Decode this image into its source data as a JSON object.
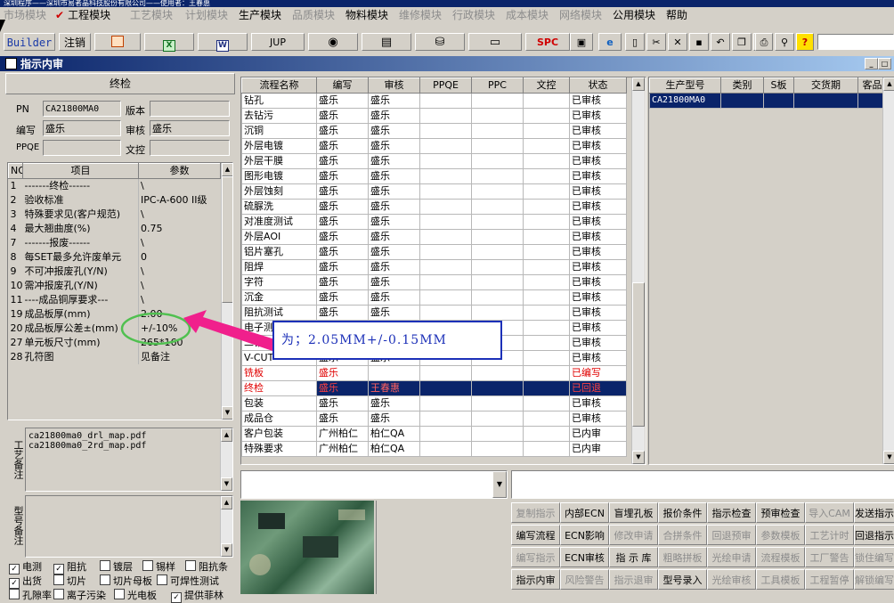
{
  "title_bar": "深圳程序——深圳市易者晶科技股份有限公司——使用者：王春惠",
  "menu": [
    {
      "label": "市场模块",
      "dim": true
    },
    {
      "label": "工程模块",
      "dim": false
    },
    {
      "label": "工艺模块",
      "dim": true
    },
    {
      "label": "计划模块",
      "dim": true
    },
    {
      "label": "生产模块",
      "dim": false
    },
    {
      "label": "品质模块",
      "dim": true
    },
    {
      "label": "物料模块",
      "dim": false
    },
    {
      "label": "维修模块",
      "dim": true
    },
    {
      "label": "行政模块",
      "dim": true
    },
    {
      "label": "成本模块",
      "dim": true
    },
    {
      "label": "网络模块",
      "dim": true
    },
    {
      "label": "公用模块",
      "dim": false
    },
    {
      "label": "帮助",
      "dim": false
    }
  ],
  "toolbar": {
    "builder": "Builder",
    "logout": "注销",
    "jup": "JUP",
    "spc": "SPC"
  },
  "window_title": "指示内审",
  "left": {
    "section_title": "终检",
    "pn_label": "PN",
    "pn_value": "CA21800MA0",
    "version_label": "版本",
    "version_value": "",
    "writer_label": "编写",
    "writer_value": "盛乐",
    "reviewer_label": "审核",
    "reviewer_value": "盛乐",
    "ppqe_label": "PPQE",
    "ppqe_value": "",
    "doc_label": "文控",
    "doc_value": "",
    "param_headers": [
      "NO",
      "项目",
      "参数"
    ],
    "params": [
      [
        "1",
        "-------终检------",
        "\\"
      ],
      [
        "2",
        "验收标准",
        "IPC-A-600 II级"
      ],
      [
        "3",
        "特殊要求见(客户规范)",
        "\\"
      ],
      [
        "4",
        "最大翘曲度(%)",
        "0.75"
      ],
      [
        "7",
        "-------报废------",
        "\\"
      ],
      [
        "8",
        "每SET最多允许废单元",
        "0"
      ],
      [
        "9",
        "不可冲报废孔(Y/N)",
        "\\"
      ],
      [
        "10",
        "需冲报废孔(Y/N)",
        "\\"
      ],
      [
        "11",
        "----成品铜厚要求---",
        "\\"
      ],
      [
        "19",
        "成品板厚(mm)",
        "2.00"
      ],
      [
        "20",
        "成品板厚公差±(mm)",
        "+/-10%"
      ],
      [
        "27",
        "单元板尺寸(mm)",
        "265*160"
      ],
      [
        "28",
        "孔符图",
        "见备注"
      ]
    ],
    "process_note_label": "工艺备注",
    "process_notes": [
      "ca21800ma0_drl_map.pdf",
      "ca21800ma0_2rd_map.pdf"
    ],
    "model_note_label": "型号备注",
    "checkboxes": [
      {
        "label": "电测",
        "checked": true
      },
      {
        "label": "阻抗",
        "checked": true
      },
      {
        "label": "镀层",
        "checked": false
      },
      {
        "label": "锡样",
        "checked": false
      },
      {
        "label": "阻抗条",
        "checked": false
      },
      {
        "label": "出货",
        "checked": true
      },
      {
        "label": "切片",
        "checked": false
      },
      {
        "label": "切片母板",
        "checked": false
      },
      {
        "label": "可焊性测试",
        "checked": false
      },
      {
        "label": "孔隙率",
        "checked": false
      },
      {
        "label": "离子污染",
        "checked": false
      },
      {
        "label": "光电板",
        "checked": false
      },
      {
        "label": "提供菲林",
        "checked": true
      }
    ]
  },
  "flow": {
    "headers": [
      "流程名称",
      "编写",
      "审核",
      "PPQE",
      "PPC",
      "文控",
      "状态"
    ],
    "rows": [
      [
        "钻孔",
        "盛乐",
        "盛乐",
        "",
        "",
        "",
        "已审核"
      ],
      [
        "去钻污",
        "盛乐",
        "盛乐",
        "",
        "",
        "",
        "已审核"
      ],
      [
        "沉铜",
        "盛乐",
        "盛乐",
        "",
        "",
        "",
        "已审核"
      ],
      [
        "外层电镀",
        "盛乐",
        "盛乐",
        "",
        "",
        "",
        "已审核"
      ],
      [
        "外层干膜",
        "盛乐",
        "盛乐",
        "",
        "",
        "",
        "已审核"
      ],
      [
        "图形电镀",
        "盛乐",
        "盛乐",
        "",
        "",
        "",
        "已审核"
      ],
      [
        "外层蚀刻",
        "盛乐",
        "盛乐",
        "",
        "",
        "",
        "已审核"
      ],
      [
        "硫脲洗",
        "盛乐",
        "盛乐",
        "",
        "",
        "",
        "已审核"
      ],
      [
        "对准度测试",
        "盛乐",
        "盛乐",
        "",
        "",
        "",
        "已审核"
      ],
      [
        "外层AOI",
        "盛乐",
        "盛乐",
        "",
        "",
        "",
        "已审核"
      ],
      [
        "铝片塞孔",
        "盛乐",
        "盛乐",
        "",
        "",
        "",
        "已审核"
      ],
      [
        "阻焊",
        "盛乐",
        "盛乐",
        "",
        "",
        "",
        "已审核"
      ],
      [
        "字符",
        "盛乐",
        "盛乐",
        "",
        "",
        "",
        "已审核"
      ],
      [
        "沉金",
        "盛乐",
        "盛乐",
        "",
        "",
        "",
        "已审核"
      ],
      [
        "阻抗测试",
        "盛乐",
        "盛乐",
        "",
        "",
        "",
        "已审核"
      ],
      [
        "电子测",
        "盛乐",
        "盛乐",
        "",
        "",
        "",
        "已审核"
      ],
      [
        "二钻",
        "盛乐",
        "盛乐",
        "",
        "",
        "",
        "已审核"
      ],
      [
        "V-CUT",
        "盛乐",
        "盛乐",
        "",
        "",
        "",
        "已审核"
      ],
      [
        "铣板",
        "盛乐",
        "",
        "",
        "",
        "",
        "已编写"
      ],
      [
        "终检",
        "盛乐",
        "王春惠",
        "",
        "",
        "",
        "已回退"
      ],
      [
        "包装",
        "盛乐",
        "盛乐",
        "",
        "",
        "",
        "已审核"
      ],
      [
        "成品仓",
        "盛乐",
        "盛乐",
        "",
        "",
        "",
        "已审核"
      ],
      [
        "客户包装",
        "广州柏仁",
        "柏仁QA",
        "",
        "",
        "",
        "已内审"
      ],
      [
        "特殊要求",
        "广州柏仁",
        "柏仁QA",
        "",
        "",
        "",
        "已内审"
      ]
    ],
    "red_row": 18,
    "selected_row": 19
  },
  "right": {
    "headers": [
      "生产型号",
      "类别",
      "S板",
      "交货期",
      "客品"
    ],
    "rows": [
      [
        "CA21800MA0",
        "",
        "",
        "",
        ""
      ]
    ]
  },
  "annotation": {
    "text": "为；2.05MM+/-0.15MM"
  },
  "actions": [
    [
      {
        "label": "复制指示",
        "dim": true
      },
      {
        "label": "内部ECN",
        "dim": false
      },
      {
        "label": "盲埋孔板",
        "dim": false
      },
      {
        "label": "报价条件",
        "dim": false
      },
      {
        "label": "指示检查",
        "dim": false
      },
      {
        "label": "预审检查",
        "dim": false
      },
      {
        "label": "导入CAM",
        "dim": true
      },
      {
        "label": "发送指示",
        "dim": false
      }
    ],
    [
      {
        "label": "编写流程",
        "dim": false
      },
      {
        "label": "ECN影响",
        "dim": false
      },
      {
        "label": "修改申请",
        "dim": true
      },
      {
        "label": "合拼条件",
        "dim": true
      },
      {
        "label": "回退预审",
        "dim": true
      },
      {
        "label": "参数模板",
        "dim": true
      },
      {
        "label": "工艺计时",
        "dim": true
      },
      {
        "label": "回退指示",
        "dim": false
      }
    ],
    [
      {
        "label": "编写指示",
        "dim": true
      },
      {
        "label": "ECN审核",
        "dim": false
      },
      {
        "label": "指 示 库",
        "dim": false
      },
      {
        "label": "粗略拼板",
        "dim": true
      },
      {
        "label": "光绘申请",
        "dim": true
      },
      {
        "label": "流程模板",
        "dim": true
      },
      {
        "label": "工厂警告",
        "dim": true
      },
      {
        "label": "锁住编写",
        "dim": true
      }
    ],
    [
      {
        "label": "指示内审",
        "dim": false
      },
      {
        "label": "风险警告",
        "dim": true
      },
      {
        "label": "指示退审",
        "dim": true
      },
      {
        "label": "型号录入",
        "dim": false
      },
      {
        "label": "光绘审核",
        "dim": true
      },
      {
        "label": "工具模板",
        "dim": true
      },
      {
        "label": "工程暂停",
        "dim": true
      },
      {
        "label": "解锁编写",
        "dim": true
      }
    ]
  ]
}
